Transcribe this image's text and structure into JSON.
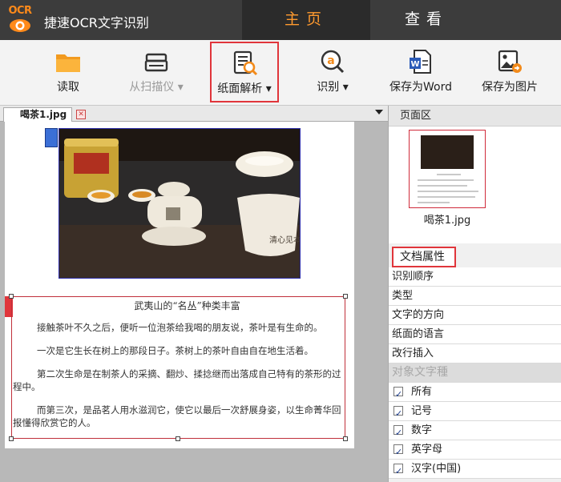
{
  "app": {
    "logo_text": "OCR",
    "title": "捷速OCR文字识别"
  },
  "nav_tabs": {
    "home": "主页",
    "view": "查看"
  },
  "toolbar": {
    "read": "读取",
    "scan": "从扫描仪",
    "parse": "纸面解析",
    "recognize": "识别",
    "save_word": "保存为Word",
    "save_image": "保存为图片"
  },
  "document": {
    "tab_label": "喝茶1.jpg",
    "heading": "武夷山的“名丛”种类丰富",
    "paragraphs": [
      "接触茶叶不久之后，便听一位泡茶给我喝的朋友说，茶叶是有生命的。",
      "一次是它生长在树上的那段日子。茶树上的茶叶自由自在地生活着。",
      "第二次生命是在制茶人的采摘、翻炒、揉捻继而出落成自己特有的茶形的过程中。",
      "而第三次，是品茗人用水滋润它，使它以最后一次舒展身姿，以生命菁华回报懂得欣赏它的人。"
    ]
  },
  "right_panel": {
    "page_area_title": "页面区",
    "thumbnail_label": "喝茶1.jpg",
    "props_title": "文档属性",
    "props": [
      "识别顺序",
      "类型",
      "文字的方向",
      "纸面的语言",
      "改行插入"
    ],
    "object_group": "对象文字種",
    "checks": [
      "所有",
      "记号",
      "数字",
      "英字母",
      "汉字(中国)"
    ]
  },
  "colors": {
    "accent": "#ff9a2e",
    "highlight_border": "#e0353b",
    "title_bar": "#3c3c3c"
  }
}
